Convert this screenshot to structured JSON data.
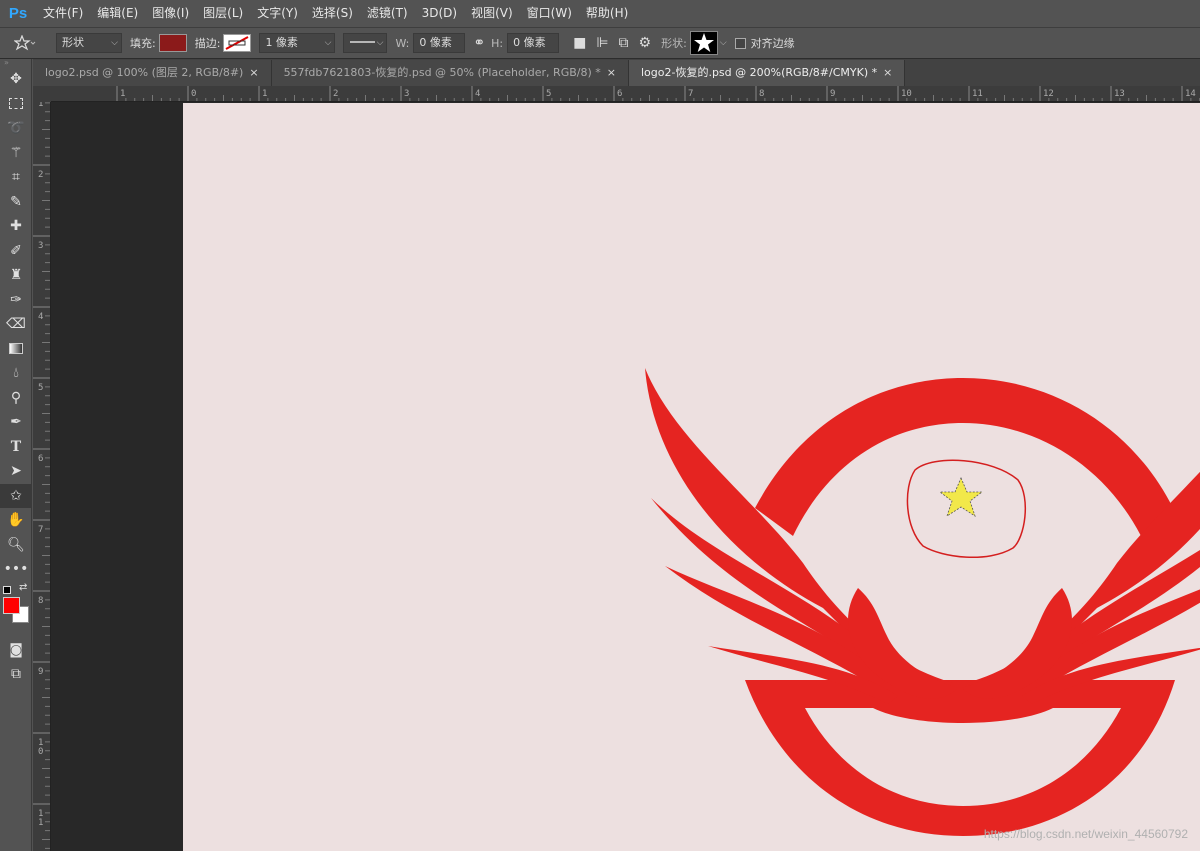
{
  "app": {
    "logo": "Ps"
  },
  "menu": [
    "文件(F)",
    "编辑(E)",
    "图像(I)",
    "图层(L)",
    "文字(Y)",
    "选择(S)",
    "滤镜(T)",
    "3D(D)",
    "视图(V)",
    "窗口(W)",
    "帮助(H)"
  ],
  "options": {
    "mode": "形状",
    "fill_label": "填充:",
    "fill_color": "#8b1a1a",
    "stroke_label": "描边:",
    "stroke_width": "1 像素",
    "w_label": "W:",
    "w_value": "0 像素",
    "h_label": "H:",
    "h_value": "0 像素",
    "shape_label": "形状:",
    "align_edges_label": "对齐边缘"
  },
  "tabs": [
    {
      "label": "logo2.psd @ 100% (图层 2, RGB/8#)",
      "close": "×"
    },
    {
      "label": "557fdb7621803-恢复的.psd @ 50% (Placeholder, RGB/8) *",
      "close": "×"
    },
    {
      "label": "logo2-恢复的.psd @ 200%(RGB/8#/CMYK) *",
      "close": "×"
    }
  ],
  "ruler_top_labels": [
    "1",
    "0",
    "1",
    "2",
    "3",
    "4",
    "5",
    "6",
    "7",
    "8",
    "9",
    "10",
    "11",
    "12",
    "13",
    "14"
  ],
  "ruler_left_labels": [
    "1",
    "2",
    "3",
    "4",
    "5",
    "6",
    "7",
    "8",
    "9",
    "1 0",
    "1 1"
  ],
  "tools": [
    "move-icon",
    "marquee-icon",
    "lasso-icon",
    "magic-wand-icon",
    "crop-icon",
    "eyedropper-icon",
    "healing-icon",
    "brush-icon",
    "stamp-icon",
    "history-brush-icon",
    "eraser-icon",
    "gradient-icon",
    "blur-icon",
    "dodge-icon",
    "pen-icon",
    "type-icon",
    "path-select-icon",
    "custom-shape-icon",
    "hand-icon",
    "zoom-icon",
    "more-icon"
  ],
  "colors": {
    "foreground": "#ff0000",
    "background": "#ffffff",
    "canvas": "#ede0e0",
    "logo_red": "#e52421",
    "star": "#f2e84a"
  },
  "watermark": "https://blog.csdn.net/weixin_44560792"
}
